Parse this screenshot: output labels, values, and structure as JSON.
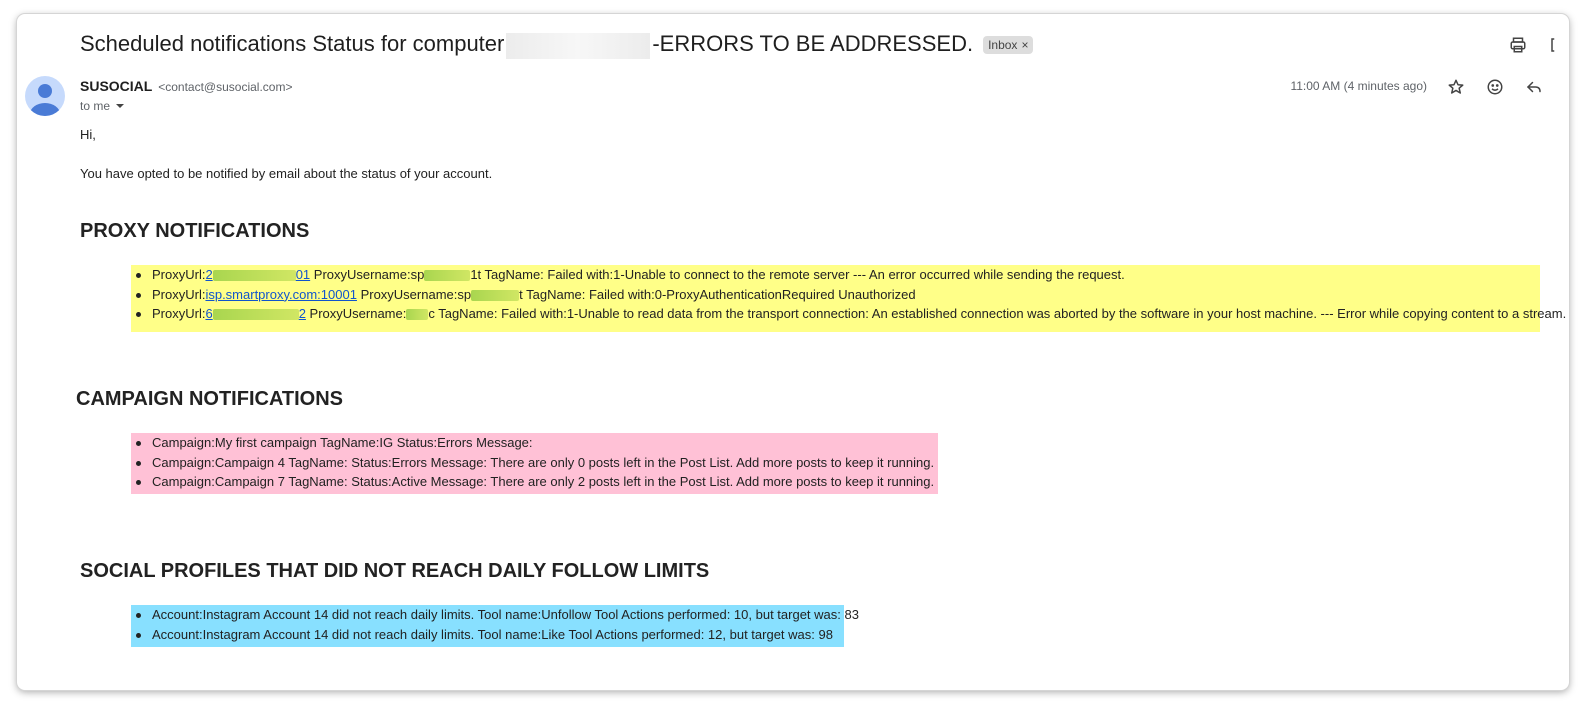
{
  "email": {
    "subject_prefix": "Scheduled notifications Status for computer",
    "subject_suffix": "-ERRORS TO BE ADDRESSED.",
    "label": "Inbox",
    "label_close": "×",
    "sender": {
      "name": "SUSOCIAL",
      "email": "<contact@susocial.com>"
    },
    "to": "to me",
    "timestamp": "11:00 AM (4 minutes ago)"
  },
  "icons": {
    "print": "printer-icon",
    "open_new": "open-in-new-icon",
    "star": "star-icon",
    "emoji": "emoji-icon",
    "reply": "reply-icon"
  },
  "body": {
    "greeting": "Hi,",
    "intro": "You have opted to be notified by email about the status of your account.",
    "proxy": {
      "heading": "PROXY NOTIFICATIONS",
      "items": [
        {
          "label": "ProxyUrl:",
          "url_a": "2",
          "url_b": "01",
          "user_label": " ProxyUsername:sp",
          "user_b": "1t",
          "rest": " TagName: Failed with:1-Unable to connect to the remote server --- An error occurred while sending the request."
        },
        {
          "label": "ProxyUrl:",
          "url_a": "isp.smartproxy.com:10001",
          "url_b": "",
          "user_label": " ProxyUsername:sp",
          "user_b": "t",
          "rest": " TagName: Failed with:0-ProxyAuthenticationRequired Unauthorized"
        },
        {
          "label": "ProxyUrl:",
          "url_a": "6",
          "url_b": "2",
          "user_label": " ProxyUsername:",
          "user_b": "c",
          "rest": " TagName: Failed with:1-Unable to read data from the transport connection: An established connection was aborted by the software in your host machine. --- Error while copying content to a stream."
        }
      ]
    },
    "campaign": {
      "heading": "CAMPAIGN NOTIFICATIONS",
      "items": [
        "Campaign:My first campaign TagName:IG Status:Errors Message:",
        "Campaign:Campaign 4 TagName: Status:Errors Message: There are only 0 posts left in the Post List. Add more posts to keep it running.",
        "Campaign:Campaign 7 TagName: Status:Active Message: There are only 2 posts left in the Post List. Add more posts to keep it running."
      ]
    },
    "social": {
      "heading": "SOCIAL PROFILES THAT DID NOT REACH DAILY FOLLOW LIMITS",
      "items": [
        "Account:Instagram Account 14 did not reach daily limits. Tool name:Unfollow Tool Actions performed: 10, but target was: 83",
        "Account:Instagram Account 14 did not reach daily limits. Tool name:Like Tool Actions performed: 12, but target was: 98"
      ]
    }
  }
}
